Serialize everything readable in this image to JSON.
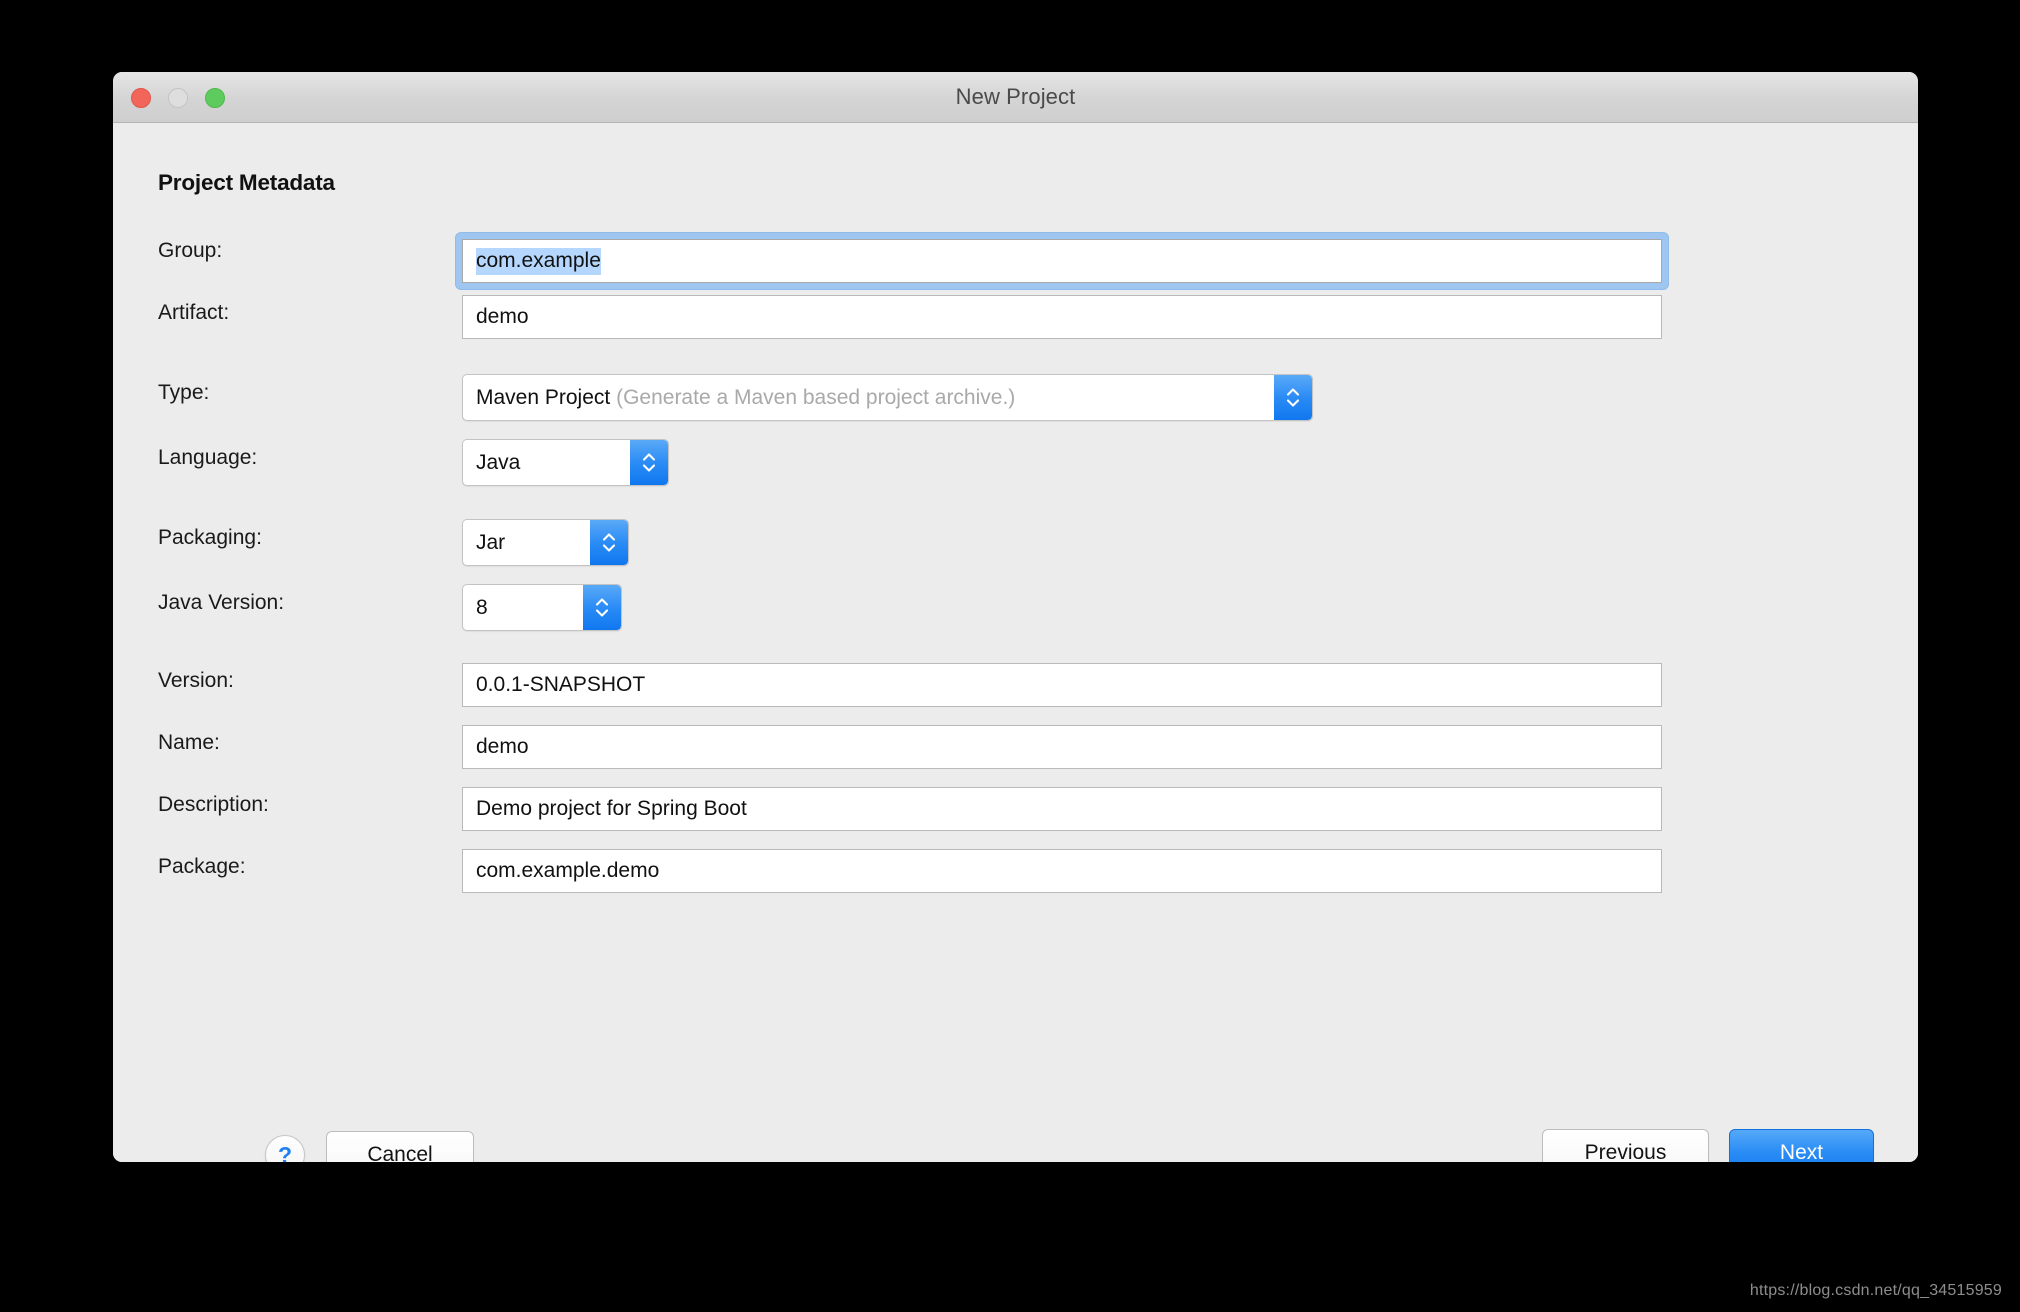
{
  "window": {
    "title": "New Project",
    "traffic_lights": [
      "close-button",
      "minimize-button",
      "zoom-button"
    ]
  },
  "section": {
    "heading": "Project Metadata"
  },
  "form": {
    "group": {
      "label": "Group:",
      "value": "com.example",
      "selected": true,
      "focused": true
    },
    "artifact": {
      "label": "Artifact:",
      "value": "demo"
    },
    "type": {
      "label": "Type:",
      "value": "Maven Project",
      "hint": "(Generate a Maven based project archive.)"
    },
    "language": {
      "label": "Language:",
      "value": "Java"
    },
    "packaging": {
      "label": "Packaging:",
      "value": "Jar"
    },
    "java_version": {
      "label": "Java Version:",
      "value": "8"
    },
    "version": {
      "label": "Version:",
      "value": "0.0.1-SNAPSHOT"
    },
    "name": {
      "label": "Name:",
      "value": "demo"
    },
    "description": {
      "label": "Description:",
      "value": "Demo project for Spring Boot"
    },
    "package": {
      "label": "Package:",
      "value": "com.example.demo"
    }
  },
  "footer": {
    "help_label": "?",
    "cancel_label": "Cancel",
    "previous_label": "Previous",
    "next_label": "Next"
  },
  "watermark": {
    "text": "https://blog.csdn.net/qq_34515959"
  },
  "colors": {
    "accent_blue": "#2b8df5",
    "selection_blue": "#b5d6fd",
    "focus_ring": "#9ec6f0",
    "dialog_bg": "#ececec",
    "titlebar_bg": "#d4d4d4",
    "help_blue": "#1e81f0",
    "hint_gray": "#a9a9a9"
  }
}
